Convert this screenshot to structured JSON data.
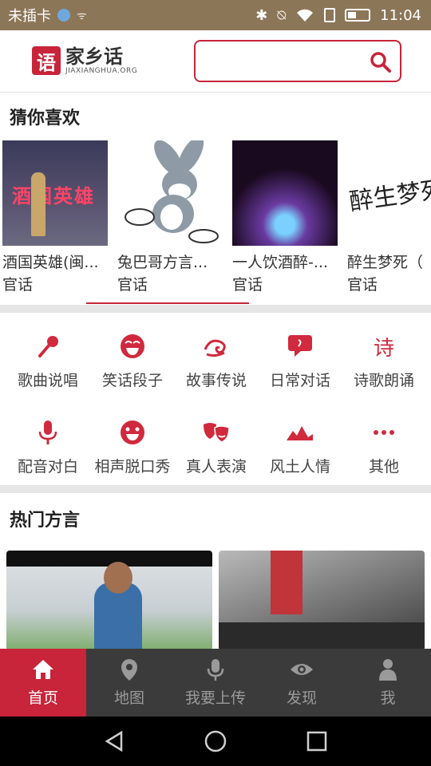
{
  "status_bar": {
    "carrier": "未插卡",
    "time": "11:04"
  },
  "header": {
    "logo_mark": "语",
    "logo_name": "家乡话",
    "logo_sub": "JIAXIANGHUA.ORG",
    "search_placeholder": ""
  },
  "recommend": {
    "title": "猜你喜欢",
    "items": [
      {
        "title": "酒国英雄(闽...",
        "dialect": "官话",
        "thumb_text": "酒国英雄"
      },
      {
        "title": "兔巴哥方言...",
        "dialect": "官话"
      },
      {
        "title": "一人饮酒醉-...",
        "dialect": "官话"
      },
      {
        "title": "醉生梦死（",
        "dialect": "官话",
        "thumb_text": "醉生梦死"
      }
    ]
  },
  "categories": [
    {
      "label": "歌曲说唱",
      "icon": "microphone-icon"
    },
    {
      "label": "笑话段子",
      "icon": "laughing-face-icon"
    },
    {
      "label": "故事传说",
      "icon": "cloud-swirl-icon"
    },
    {
      "label": "日常对话",
      "icon": "chat-bubble-icon"
    },
    {
      "label": "诗歌朗诵",
      "icon": "poem-icon",
      "glyph": "诗"
    },
    {
      "label": "配音对白",
      "icon": "studio-mic-icon"
    },
    {
      "label": "相声脱口秀",
      "icon": "smile-face-icon"
    },
    {
      "label": "真人表演",
      "icon": "theater-masks-icon"
    },
    {
      "label": "风土人情",
      "icon": "landscape-icon"
    },
    {
      "label": "其他",
      "icon": "more-dots-icon"
    }
  ],
  "hot": {
    "title": "热门方言"
  },
  "tabs": [
    {
      "label": "首页",
      "icon": "home-icon",
      "active": true
    },
    {
      "label": "地图",
      "icon": "map-pin-icon",
      "active": false
    },
    {
      "label": "我要上传",
      "icon": "upload-mic-icon",
      "active": false
    },
    {
      "label": "发现",
      "icon": "eye-icon",
      "active": false
    },
    {
      "label": "我",
      "icon": "user-icon",
      "active": false
    }
  ],
  "colors": {
    "accent": "#c8243a",
    "status_bar": "#8c7658",
    "tab_bar": "#3b3b3b"
  }
}
